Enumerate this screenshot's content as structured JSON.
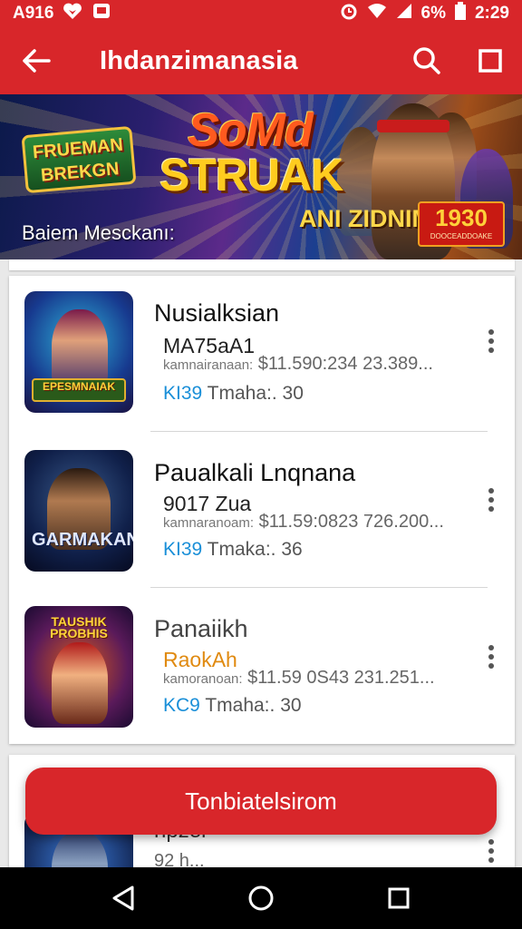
{
  "status_bar": {
    "left_text": "A916",
    "battery": "6%",
    "time": "2:29",
    "icons": [
      "heart-icon",
      "message-icon",
      "alarm-icon",
      "wifi-icon",
      "signal-icon",
      "battery-icon"
    ]
  },
  "app_bar": {
    "title": "Ihdanzimanasia",
    "back_icon": "arrow-left-icon",
    "actions": [
      "search-icon",
      "square-icon"
    ]
  },
  "banner": {
    "logo_left": "FRUEMAN BREKGN",
    "logo_main_line1": "SoMd",
    "logo_main_line2": "STRUAK",
    "tagline": "ANI ZIDNIM",
    "badge_number": "1930",
    "badge_sub": "DOOCEADDOAKE",
    "caption": "Baiem Mesckanı:"
  },
  "list": {
    "items": [
      {
        "title": "Nusialksian",
        "subtitle": "MA75aA1",
        "meta_label": "kamnairanaan:",
        "meta_value": "$11.590:234 23.389...",
        "tag_key": "KI39",
        "tag_text": "Tmaha:. 30",
        "thumb_plate": "EPESMNAIAK",
        "thumb_style": "t1"
      },
      {
        "title": "Paualkali Lnqnana",
        "subtitle": "9017 Zua",
        "meta_label": "kamnaranoam:",
        "meta_value": "$11.59:0823 726.200...",
        "tag_key": "KI39",
        "tag_text": "Tmaka:. 36",
        "thumb_plate": "GARMAKAN",
        "thumb_style": "t2"
      },
      {
        "title": "Panaiikh",
        "subtitle": "RaokAh",
        "meta_label": "kamoranoan:",
        "meta_value": "$11.59 0S43 231.251...",
        "tag_key": "KC9",
        "tag_text": "Tmaha:. 30",
        "thumb_plate": "TAUSHIK PROBHIS",
        "thumb_style": "t3"
      }
    ]
  },
  "partial_item": {
    "title": "npzer",
    "meta": "92 h..."
  },
  "fab": {
    "label": "Tonbiatelsirom"
  },
  "nav_bar": {
    "buttons": [
      "back-triangle-icon",
      "home-circle-icon",
      "recents-square-icon"
    ]
  },
  "colors": {
    "primary": "#d8262a",
    "link": "#1a8fd8",
    "orange": "#e08a10"
  }
}
